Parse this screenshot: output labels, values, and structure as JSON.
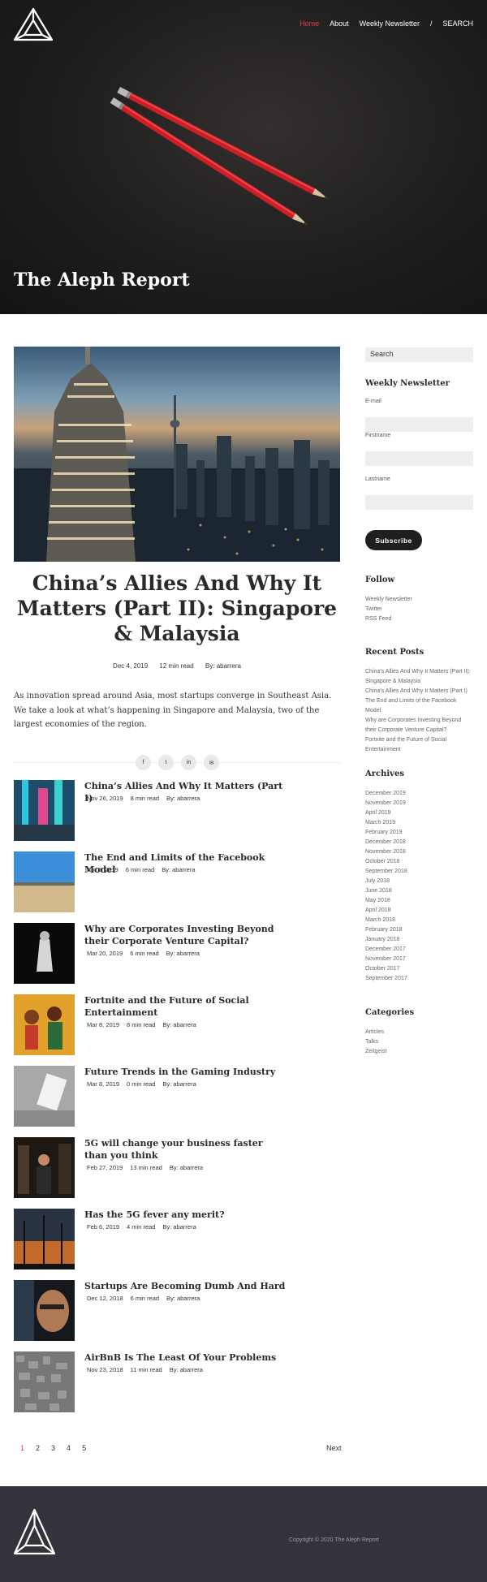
{
  "header": {
    "site_title": "The Aleph Report",
    "logo": "aleph-triangle-logo",
    "nav": [
      {
        "label": "Home",
        "active": true
      },
      {
        "label": "About",
        "active": false
      },
      {
        "label": "Weekly Newsletter",
        "active": false
      },
      {
        "label": "/",
        "active": false
      },
      {
        "label": "SEARCH",
        "active": false
      }
    ]
  },
  "featured": {
    "title": "China’s Allies And Why It Matters (Part II): Singapore & Malaysia",
    "date": "Dec 4, 2019",
    "read_time": "12 min read",
    "author": "By: abarrera",
    "excerpt": "As innovation spread around Asia, most startups converge in Southeast Asia. We take a look at what’s happening in Singapore and Malaysia, two of the largest economies of the region."
  },
  "share": {
    "icons": [
      "facebook-icon",
      "twitter-icon",
      "linkedin-icon",
      "email-icon"
    ],
    "glyphs": [
      "f",
      "t",
      "in",
      "✉"
    ]
  },
  "posts": [
    {
      "title": "China’s Allies And Why It Matters (Part I)",
      "date": "Nov 26, 2019",
      "read_time": "8 min read",
      "author": "By: abarrera"
    },
    {
      "title": "The End and Limits of the Facebook Model",
      "date": "Apr 9, 2019",
      "read_time": "6 min read",
      "author": "By: abarrera"
    },
    {
      "title": "Why are Corporates Investing Beyond their Corporate Venture Capital?",
      "date": "Mar 20, 2019",
      "read_time": "6 min read",
      "author": "By: abarrera"
    },
    {
      "title": "Fortnite and the Future of Social Entertainment",
      "date": "Mar 8, 2019",
      "read_time": "8 min read",
      "author": "By: abarrera"
    },
    {
      "title": "Future Trends in the Gaming Industry",
      "date": "Mar 8, 2019",
      "read_time": "0 min read",
      "author": "By: abarrera"
    },
    {
      "title": "5G will change your business faster than you think",
      "date": "Feb 27, 2019",
      "read_time": "13 min read",
      "author": "By: abarrera"
    },
    {
      "title": "Has the 5G fever any merit?",
      "date": "Feb 6, 2019",
      "read_time": "4 min read",
      "author": "By: abarrera"
    },
    {
      "title": "Startups Are Becoming Dumb And Hard",
      "date": "Dec 12, 2018",
      "read_time": "6 min read",
      "author": "By: abarrera"
    },
    {
      "title": "AirBnB Is The Least Of Your Problems",
      "date": "Nov 23, 2018",
      "read_time": "11 min read",
      "author": "By: abarrera"
    }
  ],
  "pagination": {
    "pages": [
      "1",
      "2",
      "3",
      "4",
      "5"
    ],
    "current": "1",
    "next": "Next"
  },
  "sidebar": {
    "search_label": "Search",
    "newsletter": {
      "heading": "Weekly Newsletter",
      "email_label": "E-mail",
      "firstname_label": "Firstname",
      "lastname_label": "Lastname",
      "subscribe": "Subscribe"
    },
    "follow": {
      "heading": "Follow",
      "links": [
        "Weekly Newsletter",
        "Twitter",
        "RSS Feed"
      ]
    },
    "recent": {
      "heading": "Recent Posts",
      "links": [
        "China's Allies And Why It Matters (Part II): Singapore & Malaysia",
        "China's Allies And Why It Matters (Part I)",
        "The End and Limits of the Facebook Model",
        "Why are Corporates Investing Beyond their Corporate Venture Capital?",
        "Fortnite and the Future of Social Entertainment"
      ]
    },
    "archives": {
      "heading": "Archives",
      "links": [
        "December 2019",
        "November 2019",
        "April 2019",
        "March 2019",
        "February 2019",
        "December 2018",
        "November 2018",
        "October 2018",
        "September 2018",
        "July 2018",
        "June 2018",
        "May 2018",
        "April 2018",
        "March 2018",
        "February 2018",
        "January 2018",
        "December 2017",
        "November 2017",
        "October 2017",
        "September 2017"
      ]
    },
    "categories": {
      "heading": "Categories",
      "links": [
        "Articles",
        "Talks",
        "Zeitgeist"
      ]
    }
  },
  "footer": {
    "copyright": "Copyright © 2020 The Aleph Report"
  },
  "colors": {
    "accent": "#e03b52",
    "footer_bg": "#32333b",
    "hero_bg": "#1f1d1d"
  }
}
